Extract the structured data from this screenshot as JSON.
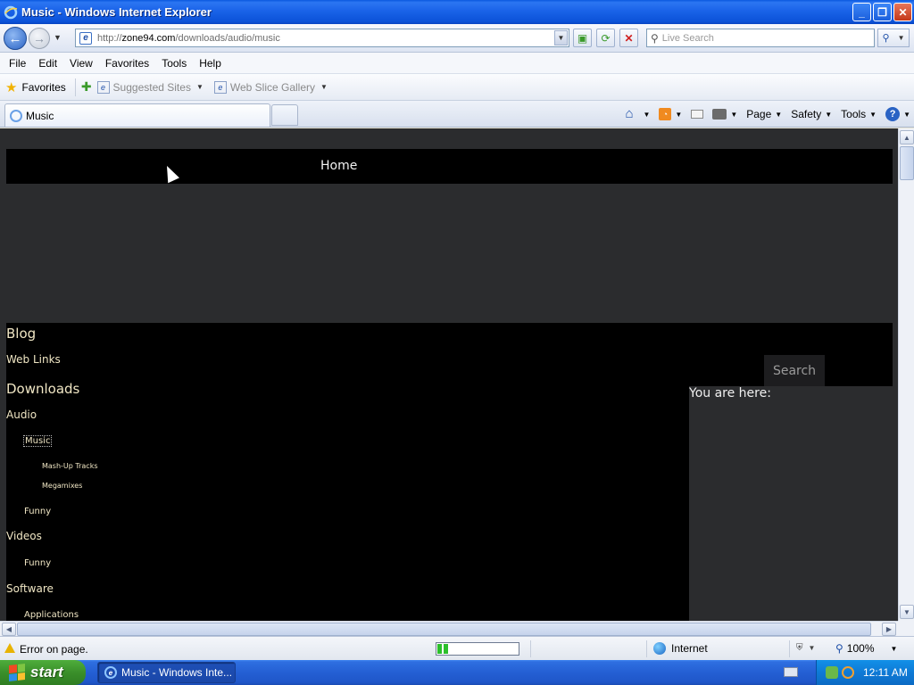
{
  "window": {
    "title": "Music - Windows Internet Explorer",
    "controls": {
      "minimize": "_",
      "maximize": "❐",
      "close": "✕"
    }
  },
  "navigation": {
    "address_prefix": "http://",
    "address_host": "zone94.com",
    "address_path": "/downloads/audio/music",
    "search_placeholder": "Live Search"
  },
  "menu": [
    "File",
    "Edit",
    "View",
    "Favorites",
    "Tools",
    "Help"
  ],
  "favorites_bar": {
    "favorites_label": "Favorites",
    "links": [
      "Suggested Sites",
      "Web Slice Gallery"
    ]
  },
  "tabs": [
    {
      "label": "Music",
      "active": true
    }
  ],
  "command_bar": {
    "page": "Page",
    "safety": "Safety",
    "tools": "Tools"
  },
  "page": {
    "top_nav": {
      "home": "Home"
    },
    "search_button": "Search",
    "breadcrumb_label": "You are here:",
    "side_nav": {
      "blog": "Blog",
      "web_links": "Web Links",
      "downloads": "Downloads",
      "audio": "Audio",
      "music": "Music",
      "mashup_tracks": "Mash-Up Tracks",
      "megamixes": "Megamixes",
      "funny_audio": "Funny",
      "videos": "Videos",
      "funny_videos": "Funny",
      "software": "Software",
      "applications": "Applications"
    },
    "colors": {
      "background": "#2b2c2e",
      "panel": "#000000",
      "link": "#f0e6c4"
    }
  },
  "status_bar": {
    "message": "Error on page.",
    "progress_fraction": 0.15,
    "zone": "Internet",
    "zoom": "100%"
  },
  "taskbar": {
    "start_label": "start",
    "window_item": "Music - Windows Inte...",
    "clock": "12:11 AM"
  }
}
